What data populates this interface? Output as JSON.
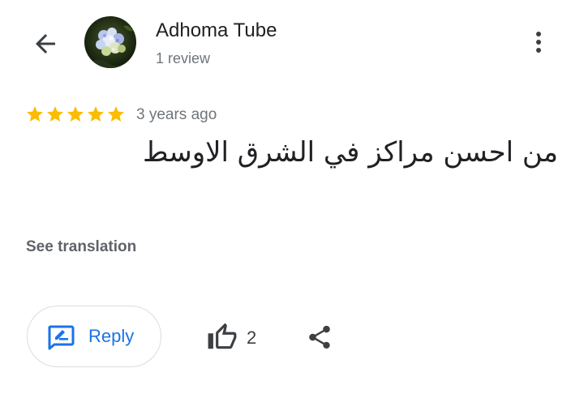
{
  "header": {
    "back_icon": "arrow-back-icon",
    "reviewer_name": "Adhoma Tube",
    "review_count": "1 review",
    "avatar_icon": "profile-photo-hydrangea",
    "more_icon": "more-vert-icon"
  },
  "review": {
    "rating": 5,
    "rating_max": 5,
    "star_color": "#fbbc04",
    "time": "3 years ago",
    "text": "من احسن مراكز في الشرق الاوسط",
    "see_translation": "See translation"
  },
  "actions": {
    "reply_label": "Reply",
    "reply_icon": "rate-review-icon",
    "like_icon": "thumb-up-outline-icon",
    "like_count": "2",
    "share_icon": "share-icon",
    "accent_color": "#1a73e8"
  }
}
